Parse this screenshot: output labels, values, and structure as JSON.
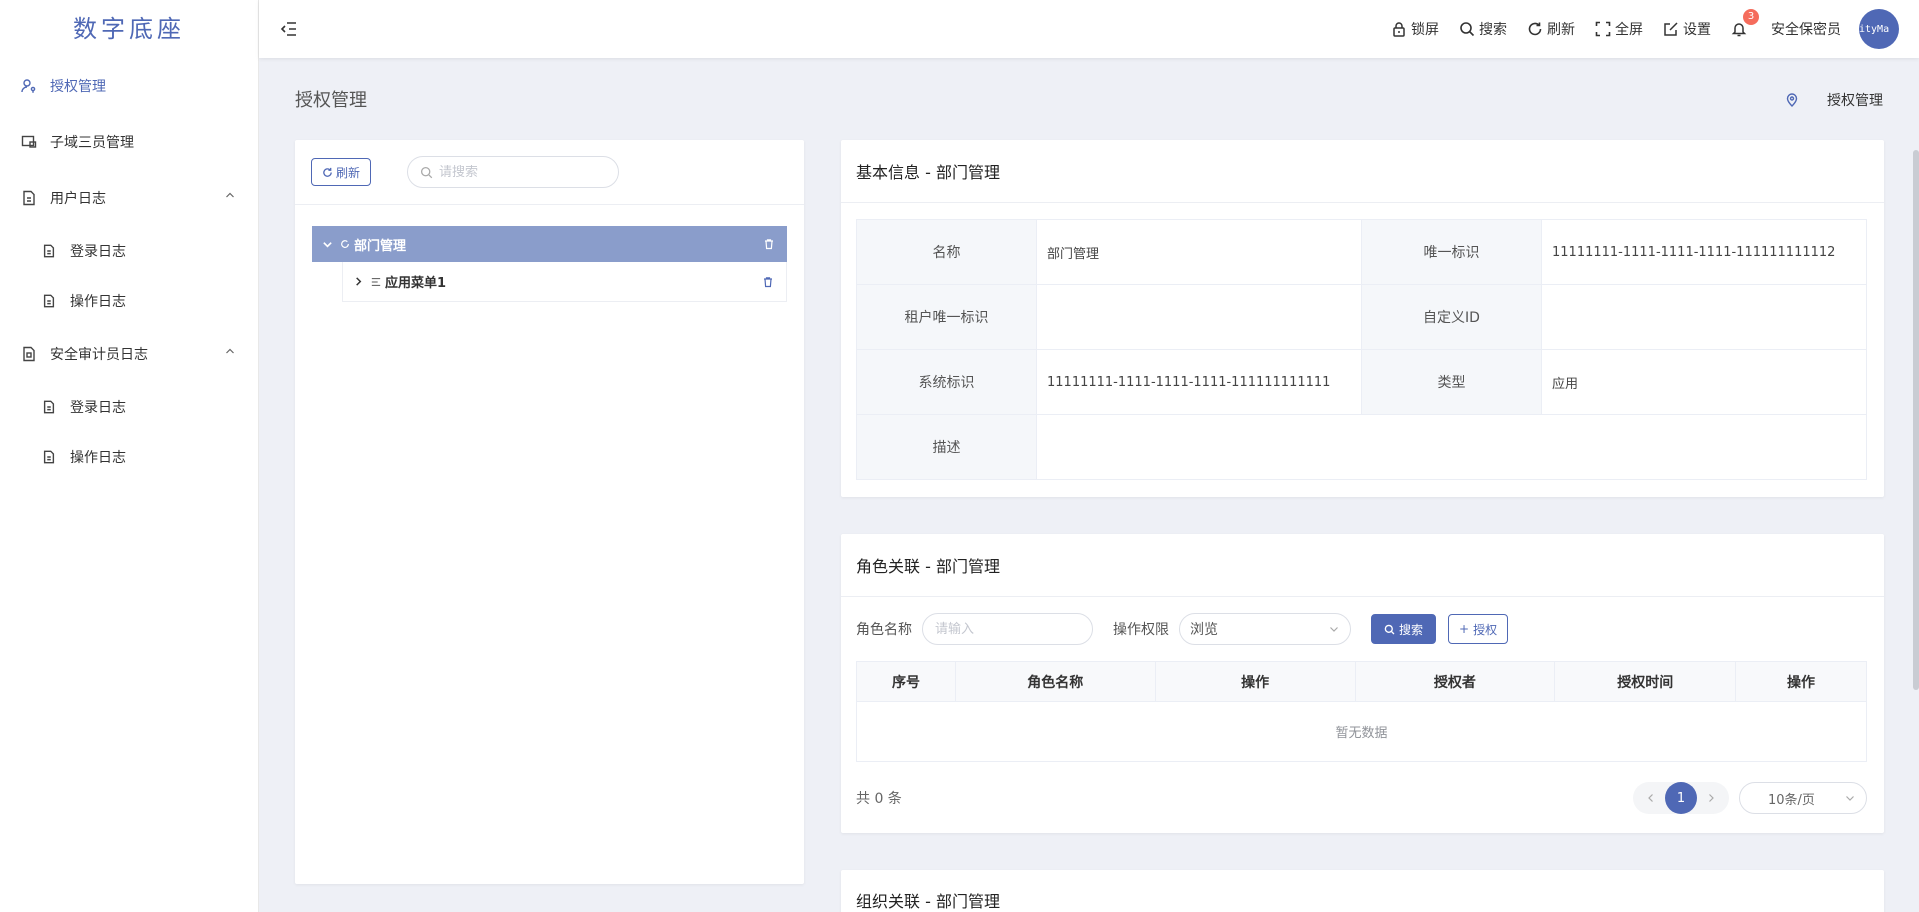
{
  "app": {
    "title": "数字底座"
  },
  "sidebar": {
    "items": [
      {
        "label": "授权管理"
      },
      {
        "label": "子域三员管理"
      },
      {
        "label": "用户日志",
        "children": [
          {
            "label": "登录日志"
          },
          {
            "label": "操作日志"
          }
        ]
      },
      {
        "label": "安全审计员日志",
        "children": [
          {
            "label": "登录日志"
          },
          {
            "label": "操作日志"
          }
        ]
      }
    ]
  },
  "header": {
    "lock": "锁屏",
    "search": "搜索",
    "refresh": "刷新",
    "fullscreen": "全屏",
    "settings": "设置",
    "notify_count": "3",
    "user": "安全保密员",
    "avatar_text": "ityMa"
  },
  "page": {
    "title": "授权管理",
    "breadcrumb": "授权管理"
  },
  "tree_panel": {
    "refresh_label": "刷新",
    "search_placeholder": "请搜索",
    "root": "部门管理",
    "child": "应用菜单1"
  },
  "basic_info": {
    "title": "基本信息 - 部门管理",
    "rows": [
      {
        "l1": "名称",
        "v1": "部门管理",
        "l2": "唯一标识",
        "v2": "11111111-1111-1111-1111-111111111112"
      },
      {
        "l1": "租户唯一标识",
        "v1": "",
        "l2": "自定义ID",
        "v2": ""
      },
      {
        "l1": "系统标识",
        "v1": "11111111-1111-1111-1111-111111111111",
        "l2": "类型",
        "v2": "应用"
      },
      {
        "l1": "描述",
        "v1": ""
      }
    ]
  },
  "role_assoc": {
    "title": "角色关联 - 部门管理",
    "role_name_label": "角色名称",
    "role_name_placeholder": "请输入",
    "perm_label": "操作权限",
    "perm_value": "浏览",
    "search_btn": "搜索",
    "grant_btn": "授权",
    "columns": [
      "序号",
      "角色名称",
      "操作",
      "授权者",
      "授权时间",
      "操作"
    ],
    "empty": "暂无数据",
    "total": "共 0 条",
    "page": "1",
    "page_size": "10条/页"
  },
  "org_assoc": {
    "title": "组织关联 - 部门管理"
  },
  "colors": {
    "primary": "#4f68b5",
    "selected_node": "#8a9dcb",
    "badge": "#f56c5c"
  }
}
